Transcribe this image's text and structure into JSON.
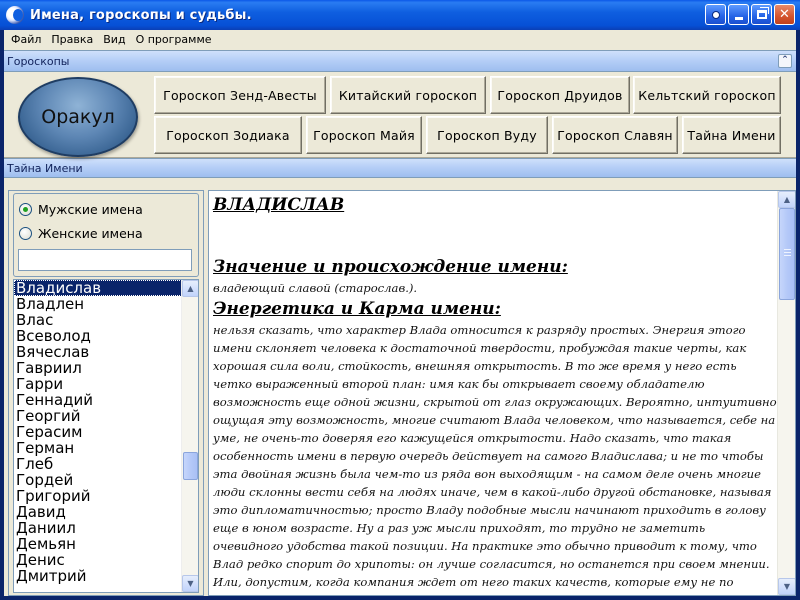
{
  "window": {
    "title": "Имена, гороскопы и судьбы."
  },
  "menu": {
    "items": [
      "Файл",
      "Правка",
      "Вид",
      "О программе"
    ]
  },
  "horoscopes_panel": {
    "title": "Гороскопы",
    "collapse_glyph": "⌃",
    "oracle_label": "Оракул",
    "buttons": [
      "Гороскоп Зенд-Авесты",
      "Китайский гороскоп",
      "Гороскоп Друидов",
      "Кельтский гороскоп",
      "Гороскоп  Зодиака",
      "Гороскоп Майя",
      "Гороскоп  Вуду",
      "Гороскоп Славян",
      "Тайна Имени"
    ]
  },
  "name_panel": {
    "title": "Тайна Имени",
    "gender_options": [
      {
        "label": "Мужские имена",
        "checked": true
      },
      {
        "label": "Женские имена",
        "checked": false
      }
    ],
    "search_value": "",
    "names": [
      "Владислав",
      "Владлен",
      "Влас",
      "Всеволод",
      "Вячеслав",
      "Гавриил",
      "Гарри",
      "Геннадий",
      "Георгий",
      "Герасим",
      "Герман",
      "Глеб",
      "Гордей",
      "Григорий",
      "Давид",
      "Даниил",
      "Демьян",
      "Денис",
      "Дмитрий"
    ],
    "selected_name": "Владислав",
    "list_scroll_position": 0.62
  },
  "article": {
    "name_heading": "ВЛАДИСЛАВ",
    "meaning_heading": "Значение и происхождение имени:",
    "meaning_text": " владеющий славой (старослав.).",
    "energy_heading": "Энергетика и Карма имени:",
    "energy_text": " нельзя сказать, что характер Влада относится к разряду простых. Энергия этого имени склоняет человека к достаточной твердости, пробуждая такие черты, как хорошая сила воли, стойкость, внешняя открытость. В то же время у него есть четко выраженный второй план: имя как бы открывает своему обладателю возможность еще одной жизни, скрытой от глаз окружающих. Вероятно, интуитивно ощущая эту возможность, многие считают Влада человеком, что называется, себе на уме, не очень-то доверяя его кажущейся открытости. Надо сказать, что такая особенность имени в первую очередь действует на самого Владислава; и не то чтобы эта двойная жизнь была чем-то из ряда вон выходящим - на самом деле очень многие люди склонны вести себя на людях иначе, чем в какой-либо другой обстановке, называя это дипломатичностью; просто Владу подобные мысли начинают приходить в голову еще в юном возрасте. Ну а раз уж мысли приходят, то трудно не заметить очевидного удобства такой позиции. На практике это обычно приводит к тому, что Влад редко спорит до хрипоты: он лучше согласится, но останется при своем мнении. Или, допустим, когда компания ждет от него таких качеств, которые ему не по",
    "scroll_position": 0.0
  },
  "colors": {
    "titlebar": "#0650d6",
    "selection": "#0a246a",
    "panel_header": "#b6cff7",
    "window_face": "#ece9d8"
  }
}
